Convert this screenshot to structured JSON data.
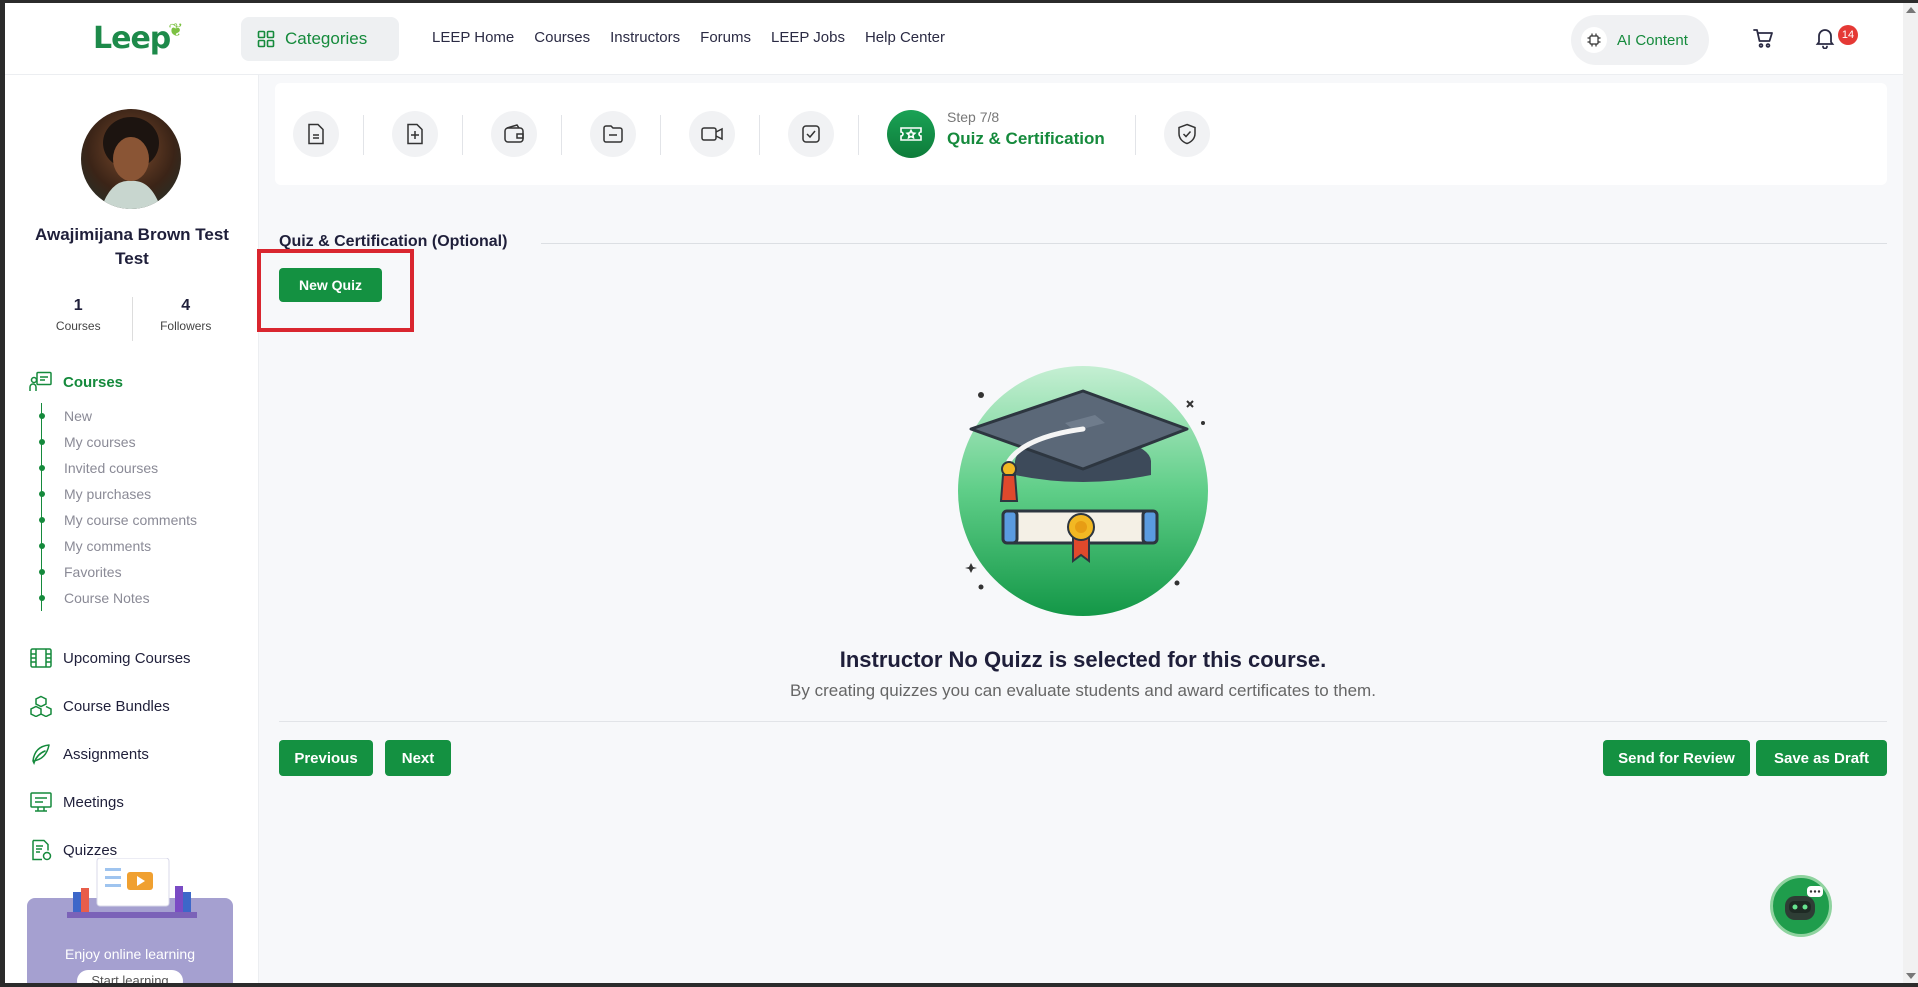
{
  "header": {
    "logo": "Leep",
    "categories_label": "Categories",
    "nav": [
      "LEEP Home",
      "Courses",
      "Instructors",
      "Forums",
      "LEEP Jobs",
      "Help Center"
    ],
    "ai_content_label": "AI Content",
    "notification_count": "14"
  },
  "sidebar": {
    "user_name": "Awajimijana Brown Test Test",
    "stats": [
      {
        "num": "1",
        "label": "Courses"
      },
      {
        "num": "4",
        "label": "Followers"
      }
    ],
    "courses_label": "Courses",
    "course_sub_items": [
      "New",
      "My courses",
      "Invited courses",
      "My purchases",
      "My course comments",
      "My comments",
      "Favorites",
      "Course Notes"
    ],
    "menu_items": [
      "Upcoming Courses",
      "Course Bundles",
      "Assignments",
      "Meetings",
      "Quizzes"
    ],
    "promo_text": "Enjoy online learning",
    "promo_button": "Start learning"
  },
  "steps": {
    "active_step_label": "Step 7/8",
    "active_step_title": "Quiz & Certification"
  },
  "main": {
    "section_title": "Quiz & Certification (Optional)",
    "new_quiz_button": "New Quiz",
    "empty_title": "Instructor No Quizz is selected for this course.",
    "empty_subtitle": "By creating quizzes you can evaluate students and award certificates to them.",
    "previous_button": "Previous",
    "next_button": "Next",
    "send_review_button": "Send for Review",
    "save_draft_button": "Save as Draft"
  },
  "colors": {
    "brand_green": "#149141",
    "highlight_red": "#d9262f",
    "badge_red": "#e53935"
  }
}
